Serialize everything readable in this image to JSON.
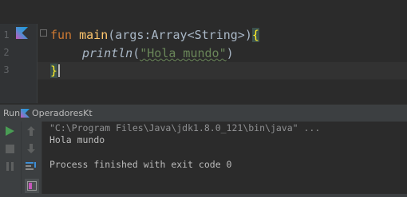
{
  "editor": {
    "line_numbers": [
      "1",
      "2",
      "3"
    ],
    "line1": {
      "kw": "fun",
      "fn": "main",
      "open_paren": "(",
      "param": "args",
      "colon": ":",
      "type": "Array<String>",
      "close_paren": ")",
      "brace": "{"
    },
    "line2": {
      "call": "println",
      "open_paren": "(",
      "string": "\"Hola mundo\"",
      "close_paren": ")"
    },
    "line3": {
      "brace": "}"
    }
  },
  "run_panel": {
    "label": "Run",
    "tab_name": "OperadoresKt",
    "console": {
      "command": "\"C:\\Program Files\\Java\\jdk1.8.0_121\\bin\\java\" ...",
      "output": "Hola mundo",
      "finish": "Process finished with exit code 0"
    }
  },
  "colors": {
    "keyword": "#cc7832",
    "function": "#ffc66d",
    "string": "#6a8759",
    "background": "#2b2b2b",
    "run_green": "#499c54"
  },
  "icons": [
    "kotlin-file-icon",
    "run-icon",
    "stop-icon",
    "pause-icon",
    "scroll-up-icon",
    "scroll-down-icon",
    "soft-wrap-icon",
    "layout-icon"
  ]
}
